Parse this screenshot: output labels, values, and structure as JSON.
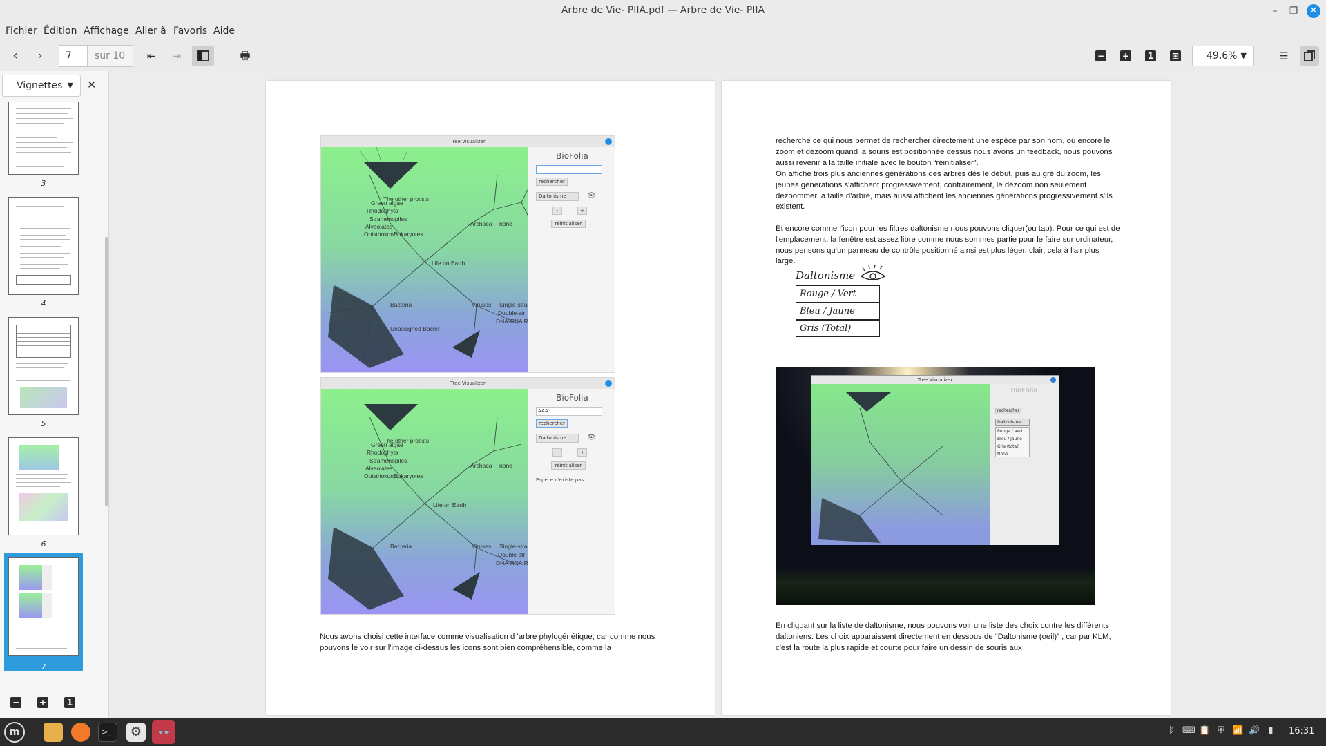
{
  "window": {
    "title": "Arbre de Vie- PIIA.pdf — Arbre de Vie- PIIA",
    "minimize_icon": "–",
    "maximize_icon": "❐",
    "close_icon": "✕"
  },
  "menu": {
    "items": [
      "Fichier",
      "Édition",
      "Affichage",
      "Aller à",
      "Favoris",
      "Aide"
    ]
  },
  "toolbar": {
    "current_page": "7",
    "total_pages": "sur 10",
    "zoom": "49,6%",
    "fit_page_label": "1"
  },
  "sidebar": {
    "mode": "Vignettes",
    "thumbnails": [
      {
        "label": "3"
      },
      {
        "label": "4"
      },
      {
        "label": "5"
      },
      {
        "label": "6"
      },
      {
        "label": "7",
        "selected": true
      }
    ],
    "footer_fit_label": "1"
  },
  "left_page": {
    "screenshot1": {
      "window_title": "Tree Visualizer",
      "app_name": "BioFolia",
      "search_value": "",
      "search_button": "rechercher",
      "filter_select": "Daltonisme",
      "minus": "-",
      "plus": "+",
      "reset_button": "réinitialiser",
      "labels": {
        "green_algae": "Green algae",
        "other_protists": "The other protists",
        "rhodophyta": "Rhodophyta",
        "stramenopiles": "Stramenopiles",
        "alveolates": "Alveolates",
        "opisthokonts": "Opisthokonts",
        "eukaryotes": "Eukaryotes",
        "archaea": "Archaea",
        "none": "none",
        "life": "Life on Earth",
        "bacteria": "Bacteria",
        "viruses": "Viruses",
        "single_str": "Single-stra",
        "double_str": "Double-str",
        "dna_rna": "DNA-RNA Re",
        "unassigned": "Unassigned Bacter"
      }
    },
    "screenshot2": {
      "window_title": "Tree Visualizer",
      "app_name": "BioFolia",
      "search_value": "AAA",
      "search_button": "rechercher",
      "filter_select": "Daltonisme",
      "minus": "-",
      "plus": "+",
      "reset_button": "réinitialiser",
      "message": "Espèce n'existe pas."
    },
    "paragraph": "Nous avons choisi cette interface comme visualisation d 'arbre phylogénétique, car comme nous pouvons le voir sur l'image ci-dessus les icons sont bien compréhensible, comme la"
  },
  "right_page": {
    "paragraph1": "recherche ce qui nous permet de rechercher directement une espèce par son nom, ou encore le zoom et dézoom quand la souris est positionnée dessus nous avons un feedback, nous pouvons aussi revenir à la taille initiale avec le bouton “réinitialiser”.",
    "paragraph2": "On affiche trois plus anciennes générations des arbres dès le début, puis au gré du zoom, les jeunes générations s'affichent progressivement, contrairement, le dézoom non seulement dézoommer la taille d'arbre, mais aussi affichent les anciennes générations progressivement s'ils existent.",
    "paragraph3": "Et encore comme l'icon pour les filtres daltonisme nous pouvons cliquer(ou tap). Pour ce qui est de l'emplacement, la fenêtre est assez libre comme nous sommes partie pour le faire sur ordinateur, nous pensons qu'un panneau de contrôle positionné ainsi est plus léger, clair, cela à l'air plus large.",
    "sketch": {
      "title": "Daltonisme",
      "rows": [
        "Rouge / Vert",
        "Bleu / Jaune",
        "Gris (Total)"
      ]
    },
    "photo": {
      "window_title": "Tree Visualizer",
      "app_name": "BioFolia",
      "search_button": "rechercher",
      "dropdown_selected": "Daltonisme",
      "dropdown_options": [
        "Rouge / Vert",
        "Bleu / Jaune",
        "Gris (total)",
        "None"
      ]
    },
    "paragraph4": "En cliquant sur la liste de daltonisme, nous pouvons voir une liste des choix contre les différents daltoniens. Les choix apparaissent directement en dessous de “Daltonisme (oeil)” , car par KLM, c'est la route la plus rapide et courte pour faire un dessin de souris aux"
  },
  "taskbar": {
    "clock": "16:31"
  },
  "colors": {
    "accent": "#2d9bdc",
    "close_button": "#1f8fe6",
    "taskbar": "#2b2b2b"
  }
}
